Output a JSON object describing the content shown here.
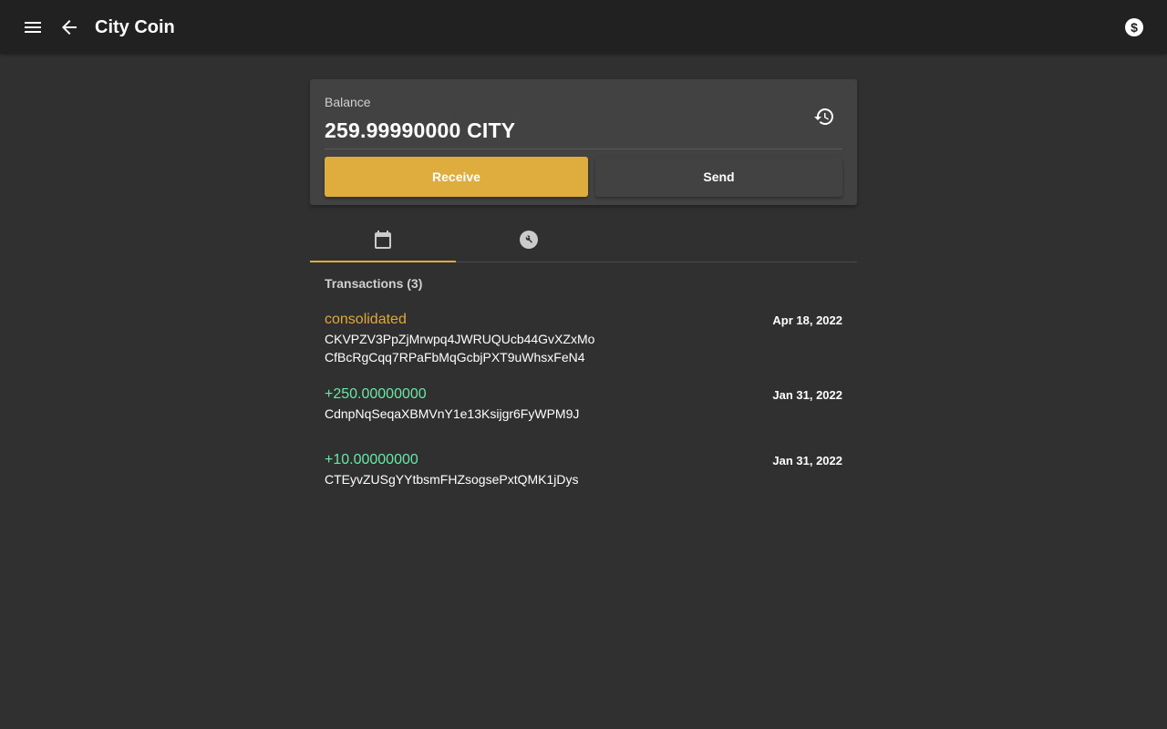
{
  "header": {
    "title": "City Coin",
    "icons": {
      "menu": "menu-icon",
      "back": "arrow-back-icon",
      "coin": "dollar-coin-icon"
    }
  },
  "balance": {
    "label": "Balance",
    "value": "259.99990000 CITY",
    "receive_label": "Receive",
    "send_label": "Send",
    "history_icon": "history-icon"
  },
  "tabs": [
    {
      "icon": "calendar-icon",
      "selected": true
    },
    {
      "icon": "wrench-icon",
      "selected": false
    }
  ],
  "transactions": {
    "header": "Transactions (3)",
    "items": [
      {
        "title": "consolidated",
        "date": "Apr 18, 2022",
        "lines": [
          "CKVPZV3PpZjMrwpq4JWRUQUcb44GvXZxMo",
          "CfBcRgCqq7RPaFbMqGcbjPXT9uWhsxFeN4"
        ]
      },
      {
        "title": "+250.00000000",
        "date": "Jan 31, 2022",
        "lines": [
          "CdnpNqSeqaXBMVnY1e13Ksijgr6FyWPM9J"
        ]
      },
      {
        "title": "+10.00000000",
        "date": "Jan 31, 2022",
        "lines": [
          "CTEyvZUSgYYtbsmFHZsogsePxtQMK1jDys"
        ]
      }
    ]
  },
  "colors": {
    "accent": "#dfad3d",
    "consolidated": "#e0a83a",
    "incoming": "#69e7a7",
    "background": "#303030",
    "toolbar": "#212121",
    "card": "#424242"
  }
}
